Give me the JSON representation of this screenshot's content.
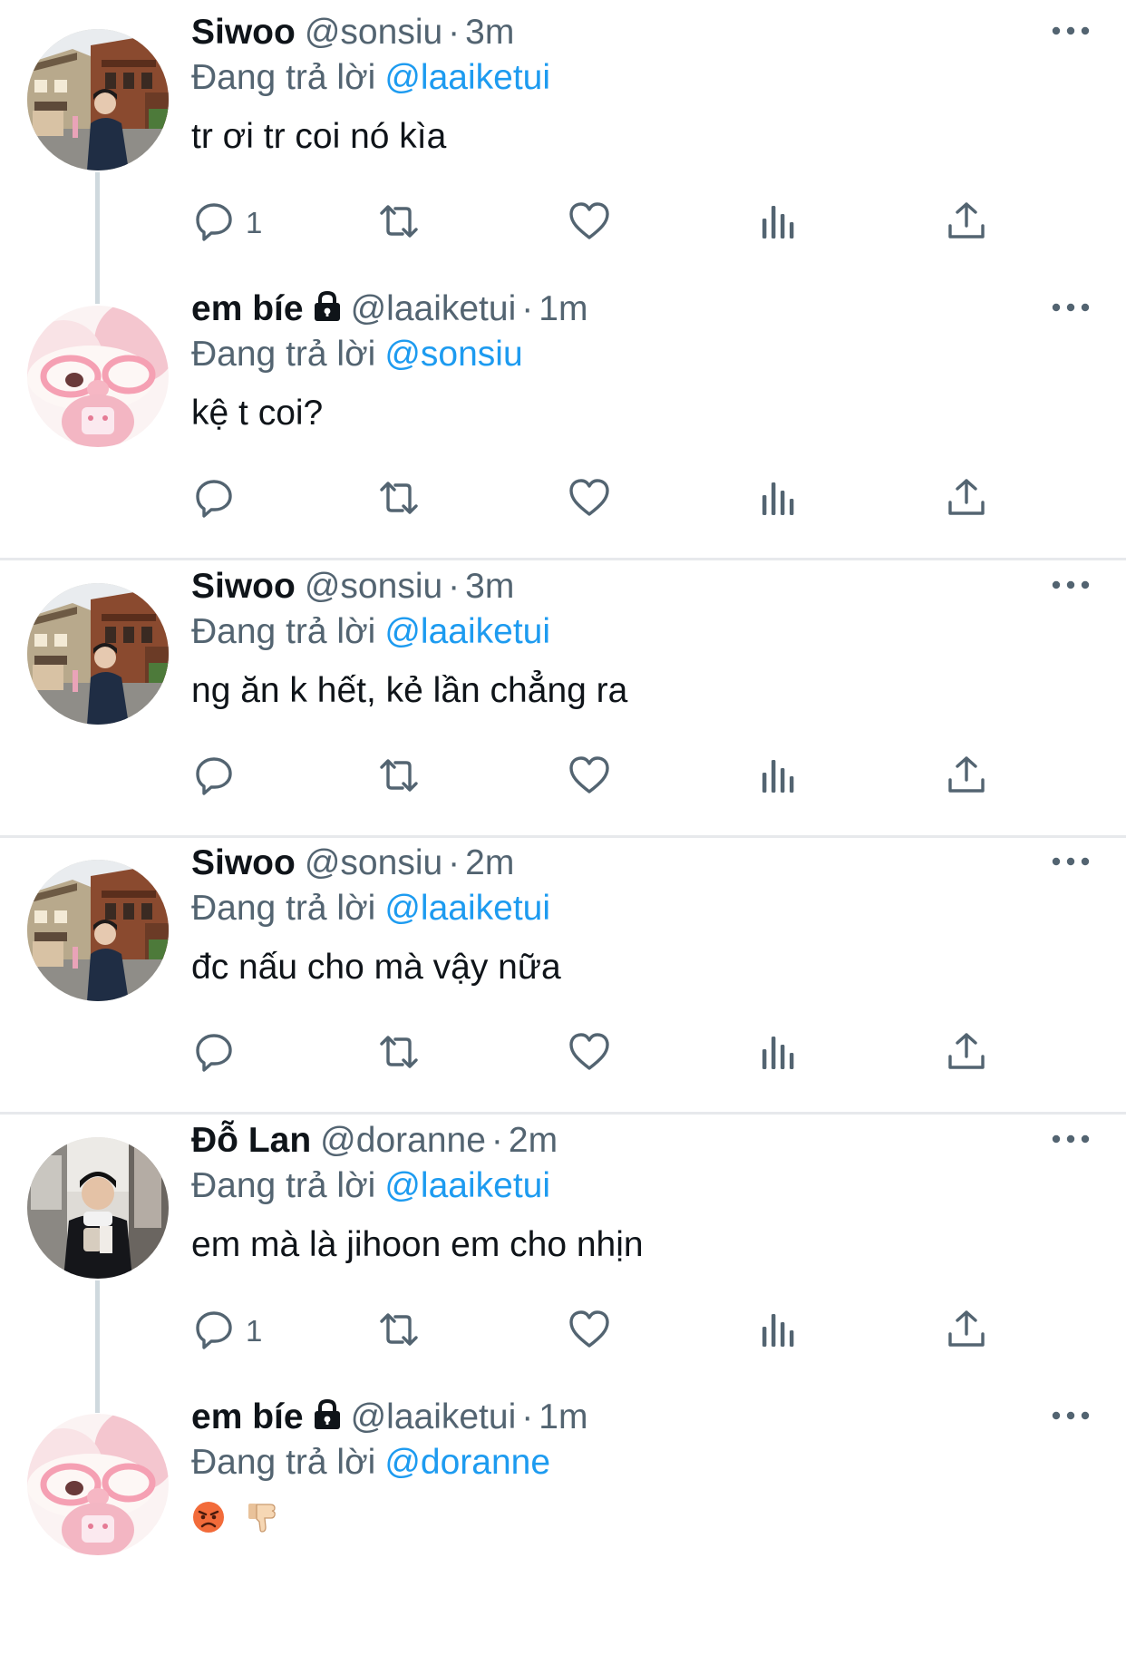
{
  "reply_prefix": "Đang trả lời",
  "colors": {
    "link": "#1d9bf0",
    "secondary": "#536471",
    "divider": "#e7e9ec"
  },
  "tweets": [
    {
      "name": "Siwoo",
      "handle": "@sonsiu",
      "time": "3m",
      "reply_to": "@laaiketui",
      "text": "tr ơi tr coi nó kìa",
      "reply_count": "1",
      "avatar_icon": "street-photo"
    },
    {
      "name": "em bíe",
      "handle": "@laaiketui",
      "time": "1m",
      "reply_to": "@sonsiu",
      "text": "kệ t coi?",
      "reply_count": "",
      "avatar_icon": "plush-toy",
      "protected": true
    },
    {
      "name": "Siwoo",
      "handle": "@sonsiu",
      "time": "3m",
      "reply_to": "@laaiketui",
      "text": "ng ăn k hết, kẻ lần chẳng ra",
      "reply_count": "",
      "avatar_icon": "street-photo"
    },
    {
      "name": "Siwoo",
      "handle": "@sonsiu",
      "time": "2m",
      "reply_to": "@laaiketui",
      "text": "đc nấu cho mà vậy nữa",
      "reply_count": "",
      "avatar_icon": "street-photo"
    },
    {
      "name": "Đỗ Lan",
      "handle": "@doranne",
      "time": "2m",
      "reply_to": "@laaiketui",
      "text": "em mà là jihoon em cho nhịn",
      "reply_count": "1",
      "avatar_icon": "selfie-photo"
    },
    {
      "name": "em bíe",
      "handle": "@laaiketui",
      "time": "1m",
      "reply_to": "@doranne",
      "text": "",
      "emojis": [
        "angry-face-emoji",
        "thumbs-down-emoji"
      ],
      "reply_count": "",
      "avatar_icon": "plush-toy",
      "protected": true
    }
  ]
}
